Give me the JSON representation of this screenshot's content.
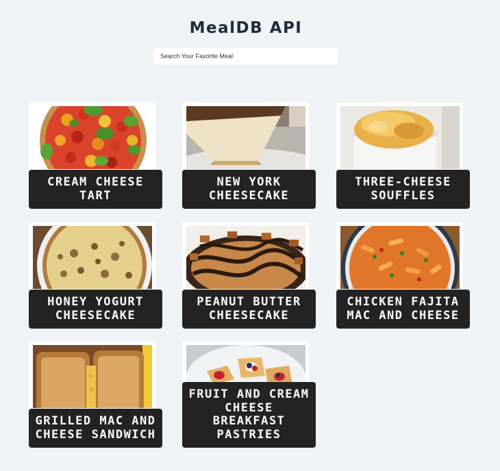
{
  "header": {
    "title": "MealDB API"
  },
  "search": {
    "placeholder": "Search Your Favorite Meal"
  },
  "meals": [
    {
      "name": "Cream Cheese Tart"
    },
    {
      "name": "New York Cheesecake"
    },
    {
      "name": "Three-cheese souffles"
    },
    {
      "name": "Honey Yogurt Cheesecake"
    },
    {
      "name": "Peanut Butter Cheesecake"
    },
    {
      "name": "Chicken Fajita Mac and Cheese"
    },
    {
      "name": "Grilled Mac and Cheese Sandwich"
    },
    {
      "name": "Fruit and Cream Cheese Breakfast Pastries"
    }
  ]
}
